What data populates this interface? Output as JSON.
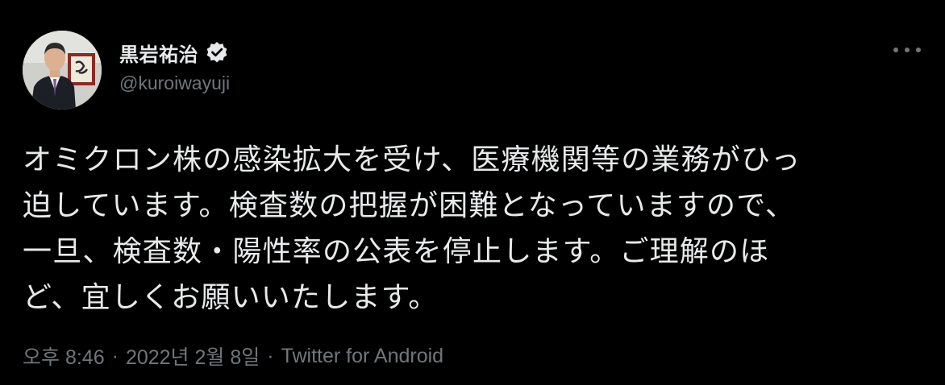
{
  "author": {
    "display_name": "黒岩祐治",
    "handle": "@kuroiwayuji",
    "verified_icon": "verified-badge-icon",
    "avatar_icon": "profile-photo"
  },
  "menu": {
    "more_icon": "more-horizontal-icon"
  },
  "tweet": {
    "lines": [
      "オミクロン株の感染拡大を受け、医療機関等の業務がひっ",
      "迫しています。検査数の把握が困難となっていますので、",
      "一旦、検査数・陽性率の公表を停止します。ご理解のほ",
      "ど、宜しくお願いいたします。"
    ]
  },
  "meta": {
    "time": "오후 8:46",
    "separator": "·",
    "date": "2022년 2월 8일",
    "source": "Twitter for Android"
  },
  "colors": {
    "background": "#000000",
    "primary_text": "#e7e9ea",
    "secondary_text": "#71767b"
  }
}
